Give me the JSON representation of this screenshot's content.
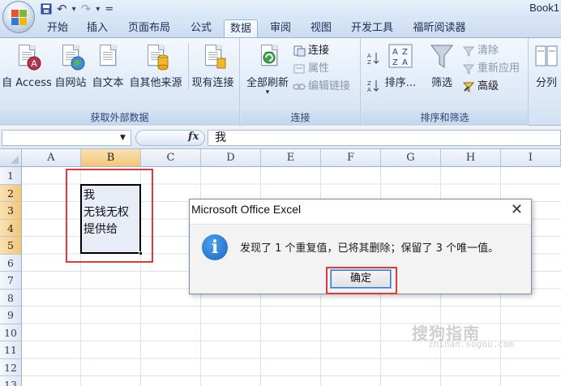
{
  "window": {
    "title": "Book1"
  },
  "qat": {
    "undo": "↶",
    "redo": "↷",
    "customize": "="
  },
  "tabs": [
    "开始",
    "插入",
    "页面布局",
    "公式",
    "数据",
    "审阅",
    "视图",
    "开发工具",
    "福昕阅读器"
  ],
  "active_tab": "数据",
  "ribbon": {
    "groups": {
      "external": "获取外部数据",
      "connections": "连接",
      "sort_filter": "排序和筛选"
    },
    "buttons": {
      "from_access": "自 Access",
      "from_web": "自网站",
      "from_text": "自文本",
      "from_other": "自其他来源",
      "existing": "现有连接",
      "refresh_all": "全部刷新",
      "connections": "连接",
      "properties": "属性",
      "edit_links": "编辑链接",
      "sort": "排序...",
      "filter": "筛选",
      "clear": "清除",
      "reapply": "重新应用",
      "advanced": "高级",
      "split": "分列"
    }
  },
  "formula_bar": {
    "fx": "fx",
    "value": "我"
  },
  "grid": {
    "columns": [
      "A",
      "B",
      "C",
      "D",
      "E",
      "F",
      "G",
      "H",
      "I"
    ],
    "rows": [
      "1",
      "2",
      "3",
      "4",
      "5",
      "6",
      "7",
      "8",
      "9",
      "10",
      "11",
      "12",
      "13"
    ],
    "cells": {
      "B2": "我",
      "B3": "无钱无权",
      "B4": "提供给"
    }
  },
  "dialog": {
    "title": "Microsoft Office Excel",
    "close": "✕",
    "icon": "i",
    "message": "发现了 1 个重复值，已将其删除；保留了 3 个唯一值。",
    "ok_label": "确定"
  },
  "watermark": {
    "text": "搜狗指南",
    "sub": "zhinan.sogou.com"
  },
  "colors": {
    "highlight": "#e5383b",
    "selection_fill": "#e7ecf7",
    "accent": "#2f7ad6"
  }
}
